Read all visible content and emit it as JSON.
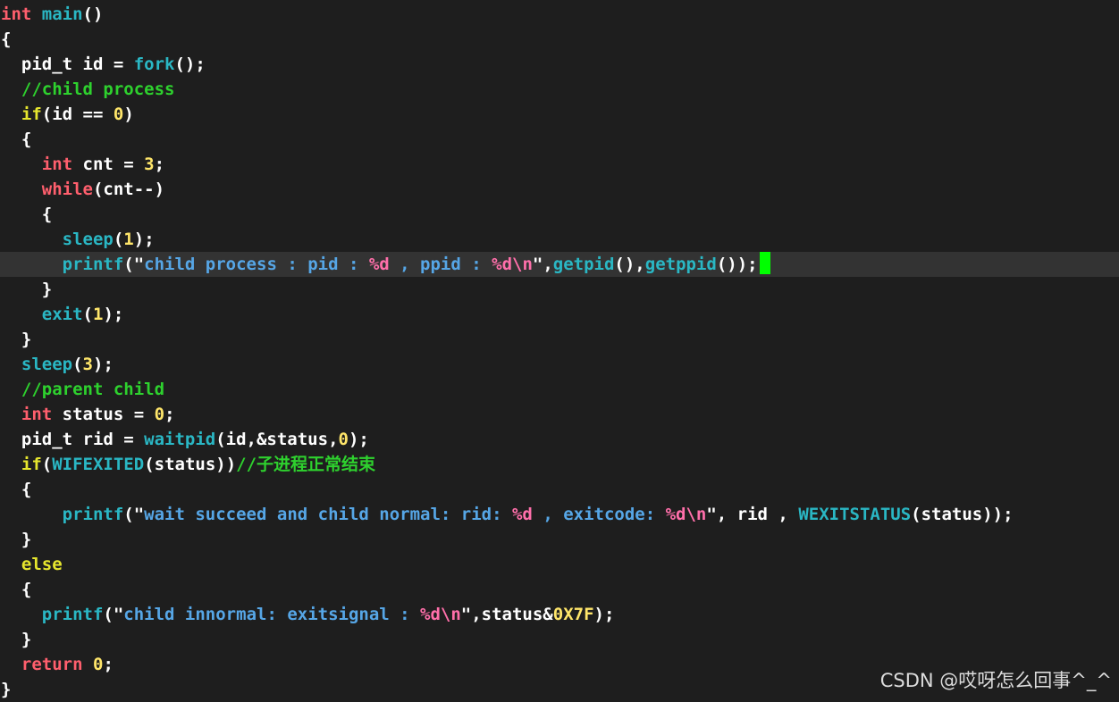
{
  "colors": {
    "background": "#1e1e1e",
    "current_line": "#333333",
    "keyword": "#ff5f6d",
    "control": "#e6e62e",
    "function": "#2ab7c4",
    "comment": "#2ed12e",
    "number": "#ffe66a",
    "string": "#56a6e6",
    "format": "#ff6faa",
    "plain": "#ffffff",
    "cursor": "#00ff00"
  },
  "editor": {
    "lines": [
      [
        [
          "keyword",
          "int"
        ],
        [
          "plain",
          " "
        ],
        [
          "function",
          "main"
        ],
        [
          "plain",
          "()"
        ]
      ],
      [
        [
          "plain",
          "{"
        ]
      ],
      [
        [
          "plain",
          "  pid_t id = "
        ],
        [
          "function",
          "fork"
        ],
        [
          "plain",
          "();"
        ]
      ],
      [
        [
          "plain",
          "  "
        ],
        [
          "comment",
          "//child process"
        ]
      ],
      [
        [
          "plain",
          "  "
        ],
        [
          "control",
          "if"
        ],
        [
          "plain",
          "(id == "
        ],
        [
          "number",
          "0"
        ],
        [
          "plain",
          ")"
        ]
      ],
      [
        [
          "plain",
          "  {"
        ]
      ],
      [
        [
          "plain",
          "    "
        ],
        [
          "keyword",
          "int"
        ],
        [
          "plain",
          " cnt = "
        ],
        [
          "number",
          "3"
        ],
        [
          "plain",
          ";"
        ]
      ],
      [
        [
          "plain",
          "    "
        ],
        [
          "keyword",
          "while"
        ],
        [
          "plain",
          "(cnt--)"
        ]
      ],
      [
        [
          "plain",
          "    {"
        ]
      ],
      [
        [
          "plain",
          "      "
        ],
        [
          "function",
          "sleep"
        ],
        [
          "plain",
          "("
        ],
        [
          "number",
          "1"
        ],
        [
          "plain",
          ");"
        ]
      ],
      [
        [
          "plain",
          "      "
        ],
        [
          "function",
          "printf"
        ],
        [
          "plain",
          "(\""
        ],
        [
          "string",
          "child process : pid : "
        ],
        [
          "format",
          "%d"
        ],
        [
          "string",
          " , ppid : "
        ],
        [
          "format",
          "%d\\n"
        ],
        [
          "plain",
          "\","
        ],
        [
          "function",
          "getpid"
        ],
        [
          "plain",
          "(),"
        ],
        [
          "function",
          "getppid"
        ],
        [
          "plain",
          "());"
        ]
      ],
      [
        [
          "plain",
          "    }"
        ]
      ],
      [
        [
          "plain",
          "    "
        ],
        [
          "function",
          "exit"
        ],
        [
          "plain",
          "("
        ],
        [
          "number",
          "1"
        ],
        [
          "plain",
          ");"
        ]
      ],
      [
        [
          "plain",
          "  }"
        ]
      ],
      [
        [
          "plain",
          "  "
        ],
        [
          "function",
          "sleep"
        ],
        [
          "plain",
          "("
        ],
        [
          "number",
          "3"
        ],
        [
          "plain",
          ");"
        ]
      ],
      [
        [
          "plain",
          "  "
        ],
        [
          "comment",
          "//parent child"
        ]
      ],
      [
        [
          "plain",
          "  "
        ],
        [
          "keyword",
          "int"
        ],
        [
          "plain",
          " status = "
        ],
        [
          "number",
          "0"
        ],
        [
          "plain",
          ";"
        ]
      ],
      [
        [
          "plain",
          "  pid_t rid = "
        ],
        [
          "function",
          "waitpid"
        ],
        [
          "plain",
          "(id,&status,"
        ],
        [
          "number",
          "0"
        ],
        [
          "plain",
          ");"
        ]
      ],
      [
        [
          "plain",
          "  "
        ],
        [
          "control",
          "if"
        ],
        [
          "plain",
          "("
        ],
        [
          "function",
          "WIFEXITED"
        ],
        [
          "plain",
          "(status))"
        ],
        [
          "comment",
          "//子进程正常结束"
        ]
      ],
      [
        [
          "plain",
          "  {"
        ]
      ],
      [
        [
          "plain",
          "      "
        ],
        [
          "function",
          "printf"
        ],
        [
          "plain",
          "(\""
        ],
        [
          "string",
          "wait succeed and child normal: rid: "
        ],
        [
          "format",
          "%d"
        ],
        [
          "string",
          " , exitcode: "
        ],
        [
          "format",
          "%d\\n"
        ],
        [
          "plain",
          "\", rid , "
        ],
        [
          "function",
          "WEXITSTATUS"
        ],
        [
          "plain",
          "(status));"
        ]
      ],
      [
        [
          "plain",
          "  }"
        ]
      ],
      [
        [
          "plain",
          "  "
        ],
        [
          "control",
          "else"
        ]
      ],
      [
        [
          "plain",
          "  {"
        ]
      ],
      [
        [
          "plain",
          "    "
        ],
        [
          "function",
          "printf"
        ],
        [
          "plain",
          "(\""
        ],
        [
          "string",
          "child innormal: exitsignal : "
        ],
        [
          "format",
          "%d\\n"
        ],
        [
          "plain",
          "\",status&"
        ],
        [
          "number",
          "0X7F"
        ],
        [
          "plain",
          ");"
        ]
      ],
      [
        [
          "plain",
          "  }"
        ]
      ],
      [
        [
          "plain",
          "  "
        ],
        [
          "keyword",
          "return"
        ],
        [
          "plain",
          " "
        ],
        [
          "number",
          "0"
        ],
        [
          "plain",
          ";"
        ]
      ],
      [
        [
          "plain",
          "}"
        ]
      ]
    ],
    "current_line_index": 10
  },
  "watermark": {
    "text": "CSDN @哎呀怎么回事^_^"
  }
}
